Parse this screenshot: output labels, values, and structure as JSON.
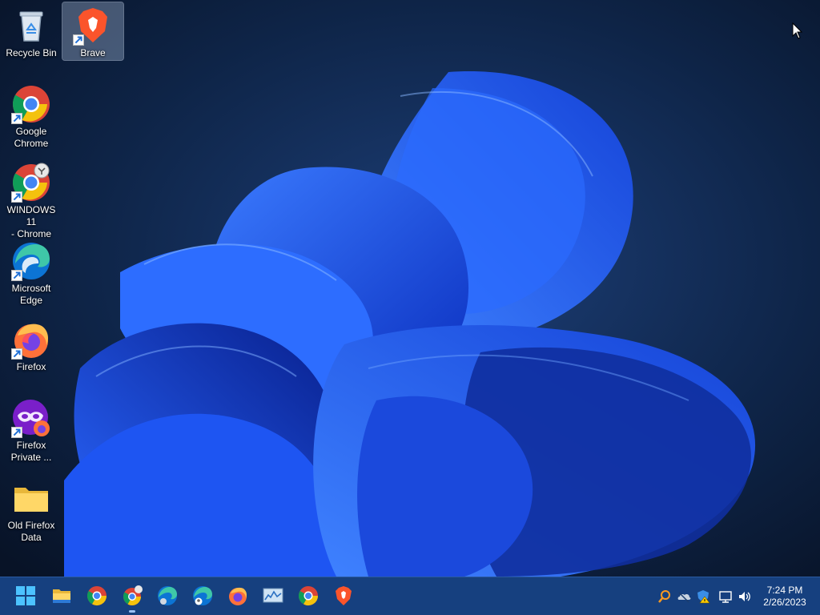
{
  "desktop": {
    "icons": [
      {
        "label": "Recycle Bin",
        "icon": "recycle-bin-icon",
        "shortcut": false
      },
      {
        "label": "Brave",
        "icon": "brave-icon",
        "shortcut": true,
        "selected": true
      },
      {
        "label": "Google\nChrome",
        "icon": "chrome-icon",
        "shortcut": true
      },
      {
        "label": "WINDOWS 11\n- Chrome",
        "icon": "chrome-profile-icon",
        "shortcut": true
      },
      {
        "label": "Microsoft\nEdge",
        "icon": "edge-icon",
        "shortcut": true
      },
      {
        "label": "Firefox",
        "icon": "firefox-icon",
        "shortcut": true
      },
      {
        "label": "Firefox\nPrivate ...",
        "icon": "firefox-private-icon",
        "shortcut": true
      },
      {
        "label": "Old Firefox\nData",
        "icon": "folder-icon",
        "shortcut": false
      }
    ]
  },
  "taskbar": {
    "apps": [
      {
        "name": "Start",
        "icon": "windows-start-icon"
      },
      {
        "name": "File Explorer",
        "icon": "file-explorer-icon"
      },
      {
        "name": "Google Chrome",
        "icon": "chrome-icon"
      },
      {
        "name": "WINDOWS 11 - Chrome",
        "icon": "chrome-profile-icon",
        "running": true
      },
      {
        "name": "Microsoft Edge",
        "icon": "edge-icon"
      },
      {
        "name": "Microsoft Edge profile",
        "icon": "edge-profile-icon"
      },
      {
        "name": "Firefox",
        "icon": "firefox-icon"
      },
      {
        "name": "Resource Monitor",
        "icon": "resource-monitor-icon"
      },
      {
        "name": "Google Chrome",
        "icon": "chrome-icon"
      },
      {
        "name": "Brave",
        "icon": "brave-icon"
      }
    ],
    "tray": [
      "search-tray-icon",
      "onedrive-offline-icon",
      "security-warning-icon",
      "network-icon",
      "volume-icon"
    ],
    "time": "7:24 PM",
    "date": "2/26/2023"
  },
  "colors": {
    "taskbar": "#16407f",
    "wallpaper_bloom": "#1a4ff0",
    "wallpaper_bg": "#0a1a33"
  }
}
